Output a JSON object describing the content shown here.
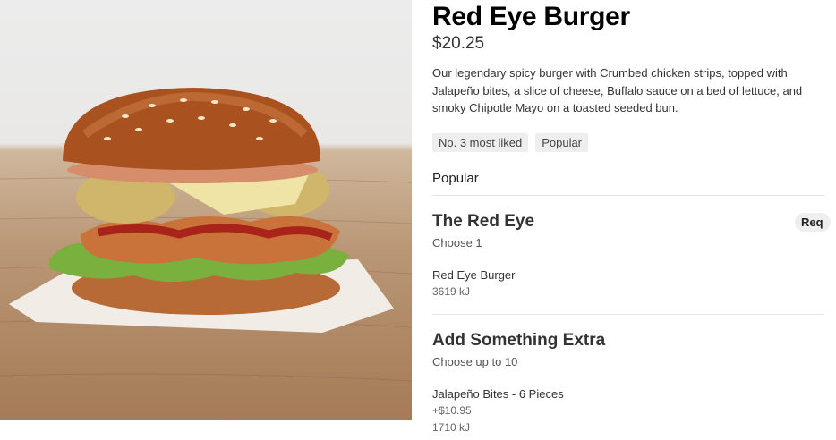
{
  "product": {
    "title": "Red Eye Burger",
    "price": "$20.25",
    "description": "Our legendary spicy burger with Crumbed chicken strips, topped with Jalapeño bites, a slice of cheese, Buffalo sauce on a bed of lettuce, and smoky Chipotle Mayo on a toasted seeded bun.",
    "badges": [
      "No. 3 most liked",
      "Popular"
    ],
    "section_label": "Popular"
  },
  "groups": [
    {
      "title": "The Red Eye",
      "subtitle": "Choose 1",
      "required_label": "Req",
      "options": [
        {
          "name": "Red Eye Burger",
          "energy": "3619 kJ"
        }
      ]
    },
    {
      "title": "Add Something Extra",
      "subtitle": "Choose up to 10",
      "options": [
        {
          "name": "Jalapeño Bites - 6 Pieces",
          "price": "+$10.95",
          "energy": "1710 kJ"
        }
      ]
    }
  ],
  "colors": {
    "accent_text": "#000000",
    "badge_bg": "#eeeeee",
    "divider": "#e4e4e4"
  }
}
